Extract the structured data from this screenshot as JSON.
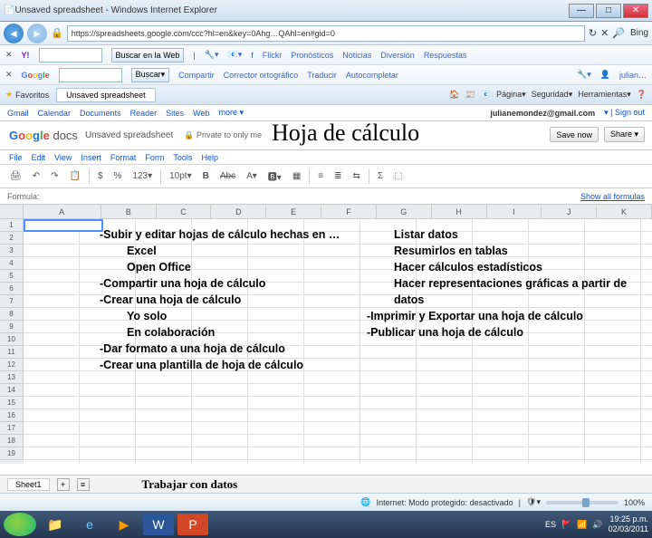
{
  "title_bar": {
    "title": "Unsaved spreadsheet - Windows Internet Explorer"
  },
  "nav": {
    "url": "https://spreadsheets.google.com/ccc?hl=en&key=0Ahg…QAhl=en#gid=0"
  },
  "bing": {
    "label": "Bing"
  },
  "tb1": {
    "search_label": "Buscar en la Web",
    "i1": "🔎",
    "i2": "📘",
    "i3": "Flickr",
    "i4": "Pronósticos",
    "i5": "Noticias",
    "i6": "Diversión",
    "i7": "Respuestas"
  },
  "tb2": {
    "g": "Google",
    "b1": "Buscar",
    "b2": "Compartir",
    "b3": "Corrector ortográfico",
    "b4": "Traducir",
    "b5": "Autocompletar",
    "user": "julian…"
  },
  "tabs": {
    "fav": "Favoritos",
    "tab": "Unsaved spreadsheet",
    "r1": "🏠",
    "r2": "📰",
    "r3": "📧",
    "r4": "Página",
    "r5": "Seguridad",
    "r6": "Herramientas",
    "r7": "❓"
  },
  "gbar": {
    "i": [
      "Gmail",
      "Calendar",
      "Documents",
      "Reader",
      "Sites",
      "Web",
      "more ▾"
    ],
    "email": "julianemondez@gmail.com",
    "sign": "▾ | Sign out"
  },
  "docs": {
    "name": "Unsaved spreadsheet",
    "priv": "🔒 Private to only me",
    "big_title": "Hoja de cálculo",
    "save": "Save now",
    "share": "Share ▾"
  },
  "menu": {
    "i": [
      "File",
      "Edit",
      "View",
      "Insert",
      "Format",
      "Form",
      "Tools",
      "Help"
    ]
  },
  "fmt": {
    "items": [
      "🖨",
      "↶",
      "↷",
      "📋",
      "$",
      "%",
      "123▾",
      "10pt▾",
      "B",
      "Abc",
      "A▾",
      "🅱▾",
      "▦",
      "≡",
      "≣",
      "⇆",
      "Σ",
      "⬚"
    ]
  },
  "fx": {
    "label": "Formula:",
    "show": "Show all formulas"
  },
  "cols": [
    "A",
    "B",
    "C",
    "D",
    "E",
    "F",
    "G",
    "H",
    "I",
    "J",
    "K"
  ],
  "rows": [
    "1",
    "2",
    "3",
    "4",
    "5",
    "6",
    "7",
    "8",
    "9",
    "10",
    "11",
    "12",
    "13",
    "14",
    "15",
    "16",
    "17",
    "18",
    "19"
  ],
  "content": {
    "left": [
      "-Subir y editar hojas de cálculo hechas en …",
      "Excel",
      "Open Office",
      "-Compartir una hoja de cálculo",
      "-Crear una hoja de cálculo",
      "Yo solo",
      "En colaboración",
      "-Dar formato a una hoja de cálculo",
      "-Crear una plantilla de hoja de cálculo"
    ],
    "right": [
      "Listar datos",
      "Resumirlos en tablas",
      "Hacer cálculos estadísticos",
      "Hacer representaciones gráficas a partir de",
      "datos",
      "-Imprimir y Exportar una hoja de cálculo",
      "-Publicar una hoja de cálculo"
    ]
  },
  "sheet_tabs": {
    "s1": "Sheet1",
    "work": "Trabajar con datos"
  },
  "status": {
    "msg": "Internet: Modo protegido: desactivado",
    "zoom": "100%"
  },
  "taskbar": {
    "time": "19:25 p.m.",
    "date": "02/03/2011",
    "lang": "ES"
  }
}
